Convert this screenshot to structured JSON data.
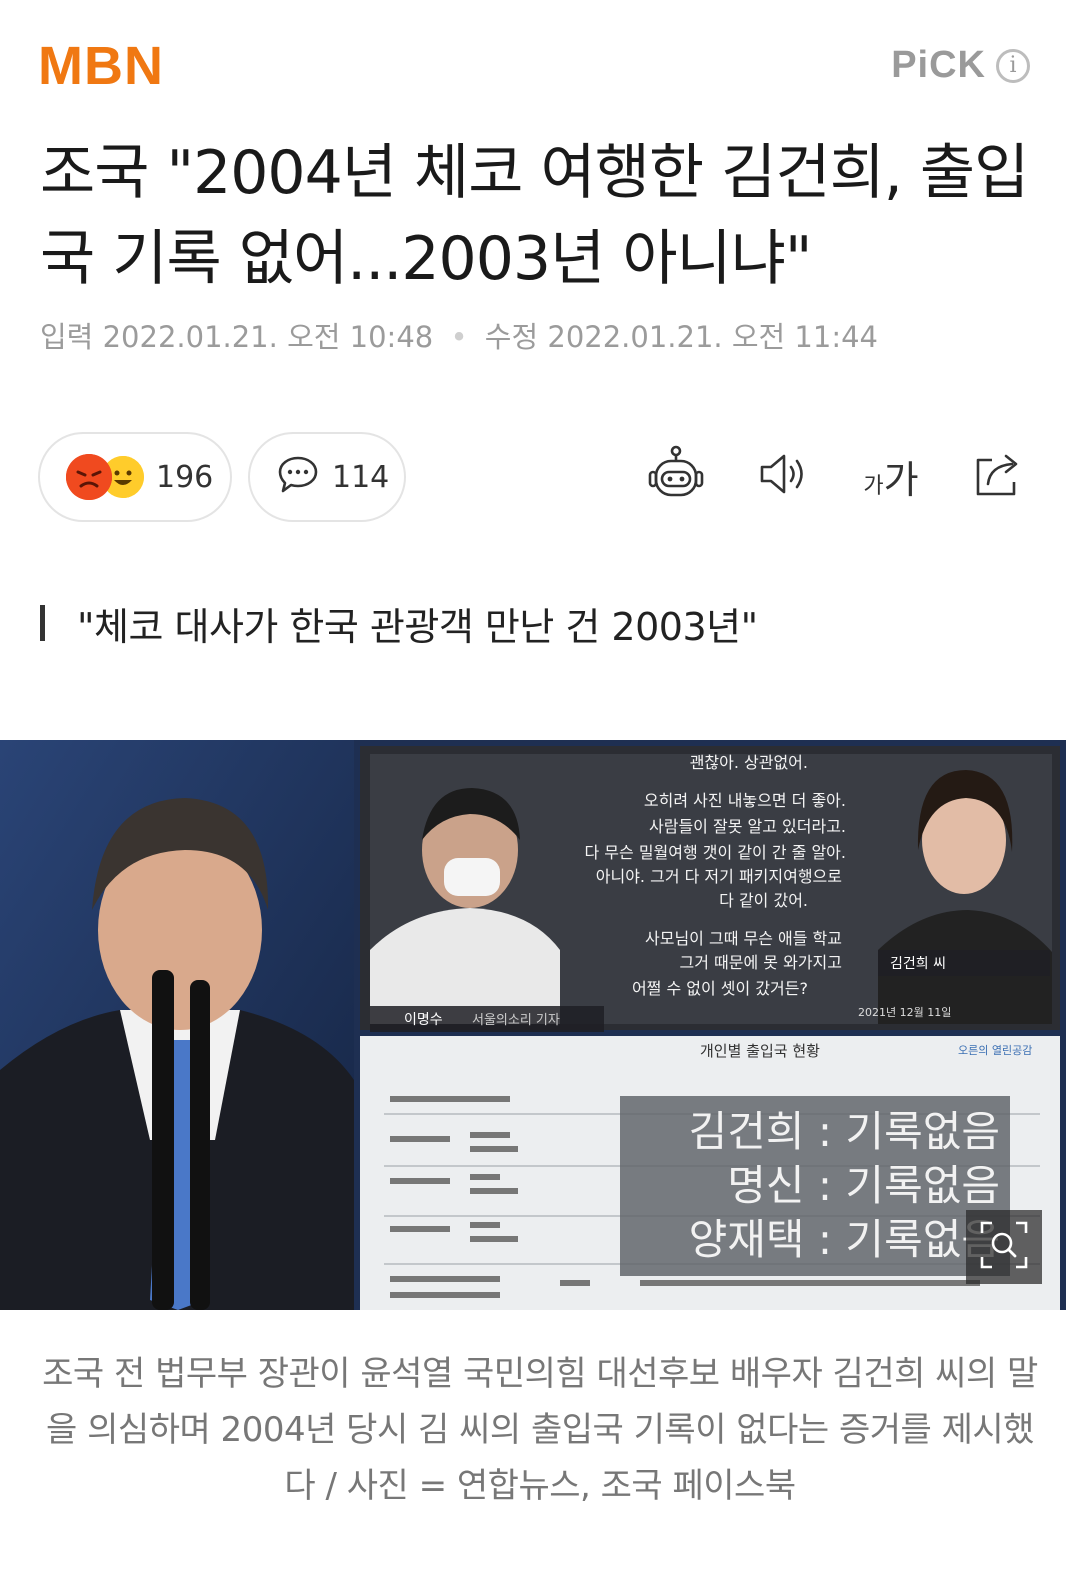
{
  "header": {
    "logo": "MBN",
    "pick_label": "PiCK",
    "info_symbol": "i"
  },
  "article": {
    "headline": "조국 \"2004년 체코 여행한 김건희, 출입국 기록 없어...2003년 아니냐\"",
    "input_label": "입력",
    "input_date": "2022.01.21. 오전 10:48",
    "edit_label": "수정",
    "edit_date": "2022.01.21. 오전 11:44",
    "subheadline": "\"체코 대사가 한국 관광객 만난 건 2003년\"",
    "reactions_count": "196",
    "comments_count": "114",
    "font_tool_small": "가",
    "font_tool_big": "가",
    "caption": "조국 전 법무부 장관이 윤석열 국민의힘 대선후보 배우자 김건희 씨의 말을 의심하며 2004년 당시 김 씨의 출입국 기록이 없다는 증거를 제시했다 / 사진 = 연합뉴스, 조국 페이스북"
  },
  "photo": {
    "quote_lines": [
      "괜찮아. 상관없어.",
      "오히려 사진 내놓으면 더 좋아.",
      "사람들이 잘못 알고 있더라고.",
      "다 무슨 밀월여행 갯이 같이 간 줄 알아.",
      "아니야. 그거 다 저기 패키지여행으로",
      "다 같이 갔어.",
      "사모님이 그때 무슨 애들 학교",
      "그거 때문에 못 와가지고",
      "어쩔 수 없이 셋이 갔거든?"
    ],
    "reporter_name": "이명수",
    "reporter_title": "서울의소리 기자",
    "subject_name": "김건희 씨",
    "tv_date": "2021년 12월 11일",
    "doc_title": "개인별 출입국 현황",
    "source_mark": "오른의 열린공감",
    "record_lines": [
      "김건희 : 기록없음",
      "명신 : 기록없음",
      "양재택 : 기록없음"
    ]
  },
  "icons": {
    "reaction": "emoji-reaction-icon",
    "comment": "speech-bubble-icon",
    "summary_bot": "robot-icon",
    "listen": "speaker-icon",
    "font_size": "font-size-icon",
    "share": "share-icon",
    "zoom": "zoom-icon"
  },
  "colors": {
    "brand": "#f07812",
    "muted_text": "#9b9b9b",
    "pill_border": "#e4e4e4",
    "photo_bg": "#1e2f52"
  }
}
